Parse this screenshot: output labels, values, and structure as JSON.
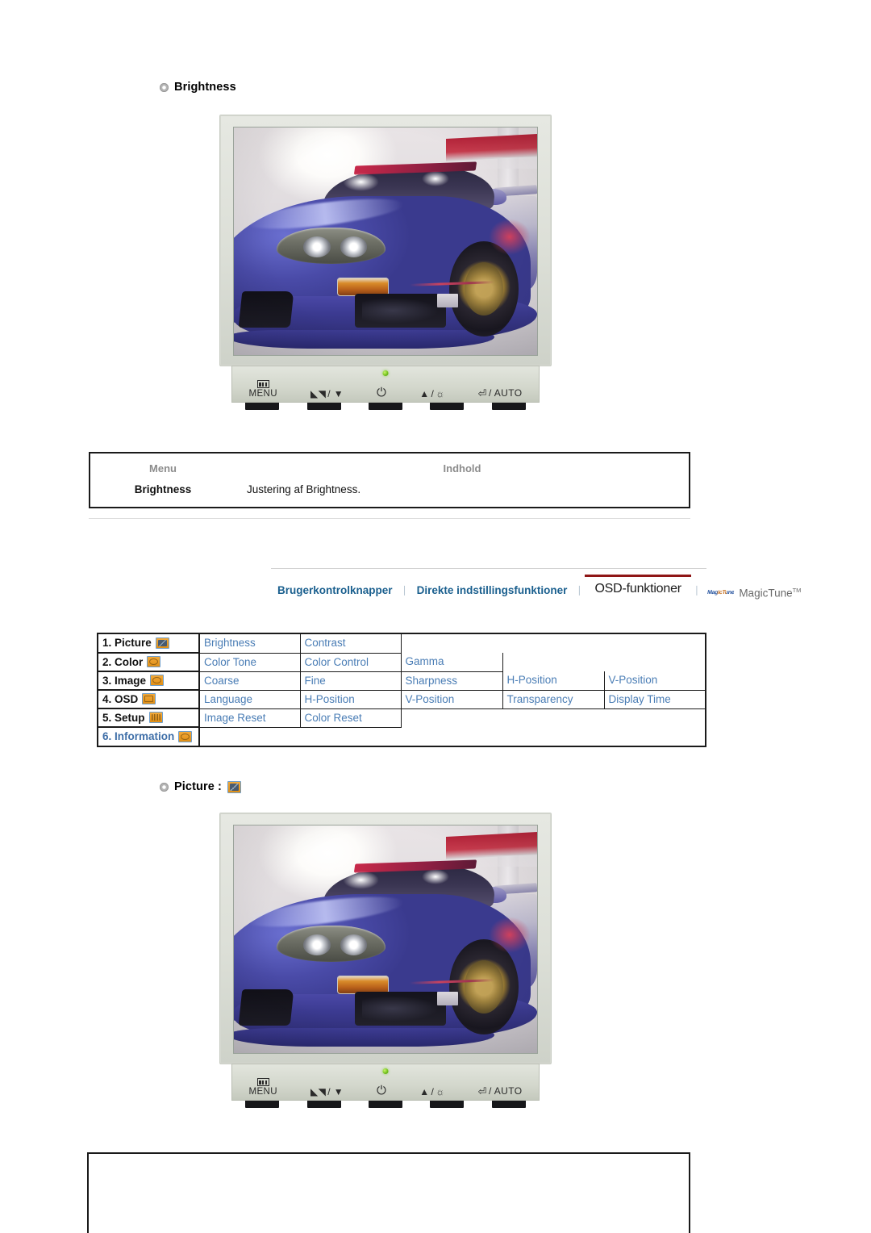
{
  "page": {
    "sections": [
      {
        "id": "brightness",
        "icon": "bullet-icon",
        "title": "Brightness"
      },
      {
        "id": "picture",
        "icon": "bullet-icon",
        "title": "Picture :"
      }
    ]
  },
  "monitor": {
    "panel_buttons": [
      {
        "name": "menu-button",
        "glyph": "menu-bars",
        "label": "MENU"
      },
      {
        "name": "down-button",
        "glyph": "▲▲",
        "label": "/ ▼"
      },
      {
        "name": "power-button",
        "glyph": "⏻",
        "label": ""
      },
      {
        "name": "up-brightness-button",
        "glyph": "▲",
        "label": "/ ☼"
      },
      {
        "name": "enter-auto-button",
        "glyph": "⏎",
        "label": "/ AUTO"
      }
    ],
    "menu_text": "MENU",
    "down_text": "/ ▼",
    "power_text": "⏻",
    "up_text": "▲",
    "up_sep": "/",
    "brightness_sym": "☼",
    "enter_sym": "⏎",
    "auto_text": "/ AUTO",
    "led_name": "power-led"
  },
  "info_table": {
    "headers": {
      "menu": "Menu",
      "content": "Indhold"
    },
    "rows": [
      {
        "menu": "Brightness",
        "content": "Justering af Brightness."
      }
    ]
  },
  "nav": {
    "items": [
      {
        "label": "Brugerkontrolknapper",
        "active": false
      },
      {
        "label": "Direkte indstillingsfunktioner",
        "active": false
      },
      {
        "label": "OSD-funktioner",
        "active": true
      }
    ],
    "separator": "❘",
    "magictune": {
      "badge": "MagicTune",
      "name": "MagicTune",
      "tm": "TM"
    },
    "active_underline_color": "#8f1616",
    "link_color": "#1a5f8e"
  },
  "osd_menu": {
    "link_color": "#4a7db5",
    "rows": [
      {
        "label": "1. Picture",
        "icon": "picture-icon",
        "icon_style": "pic",
        "items": [
          "Brightness",
          "Contrast"
        ]
      },
      {
        "label": "2. Color",
        "icon": "color-icon",
        "icon_style": "round",
        "items": [
          "Color Tone",
          "Color Control",
          "Gamma"
        ]
      },
      {
        "label": "3. Image",
        "icon": "image-icon",
        "icon_style": "round",
        "items": [
          "Coarse",
          "Fine",
          "Sharpness",
          "H-Position",
          "V-Position"
        ]
      },
      {
        "label": "4. OSD",
        "icon": "osd-icon",
        "icon_style": "plain",
        "items": [
          "Language",
          "H-Position",
          "V-Position",
          "Transparency",
          "Display Time"
        ]
      },
      {
        "label": "5. Setup",
        "icon": "setup-icon",
        "icon_style": "barsdeco",
        "items": [
          "Image Reset",
          "Color Reset"
        ]
      },
      {
        "label": "6. Information",
        "icon": "information-icon",
        "icon_style": "clock",
        "items": []
      }
    ]
  }
}
